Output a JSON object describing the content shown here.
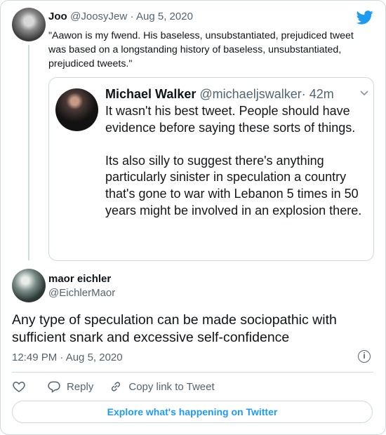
{
  "parent_tweet": {
    "author_name": "Joo",
    "author_handle": "@JoosyJew",
    "date": "· Aug 5, 2020",
    "text": "\"Aawon is my fwend. His baseless, unsubstantiated, prejudiced tweet was based on a longstanding history of baseless, unsubstantiated, prejudiced tweets.\"",
    "quoted_tweet": {
      "author_name": "Michael Walker",
      "author_handle": "@michaeljswalker",
      "age": "· 42m",
      "text": "It wasn't his best tweet. People should have evidence before saying these sorts of things.\n\nIts also silly to suggest there's anything particularly sinister in speculation a country that's gone to war with Lebanon 5 times in 50 years might be involved in an explosion there."
    }
  },
  "main_tweet": {
    "author_name": "maor eichler",
    "author_handle": "@EichlerMaor",
    "text": "Any type of speculation can be made sociopathic with sufficient snark and excessive self-confidence",
    "timestamp": "12:49 PM · Aug 5, 2020",
    "info_icon": "i"
  },
  "actions": {
    "reply_label": "Reply",
    "copy_link_label": "Copy link to Tweet"
  },
  "explore_label": "Explore what's happening on Twitter",
  "colors": {
    "twitter_blue": "#1d9bf0",
    "muted_text": "#536471",
    "border": "#cfd9de"
  },
  "icons": [
    "twitter-bird-icon",
    "chevron-down-icon",
    "info-icon",
    "heart-icon",
    "reply-icon",
    "link-icon"
  ]
}
